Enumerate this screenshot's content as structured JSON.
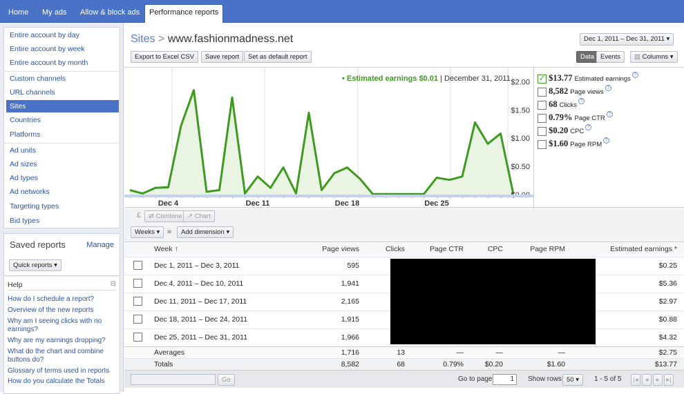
{
  "nav": {
    "tabs": [
      "Home",
      "My ads",
      "Allow & block ads",
      "Performance reports"
    ]
  },
  "sidebar": {
    "group1": [
      "Entire account by day",
      "Entire account by week",
      "Entire account by month"
    ],
    "group2": [
      "Custom channels",
      "URL channels",
      "Sites",
      "Countries",
      "Platforms"
    ],
    "group3": [
      "Ad units",
      "Ad sizes",
      "Ad types",
      "Ad networks",
      "Targeting types",
      "Bid types"
    ],
    "saved_title": "Saved reports",
    "manage": "Manage",
    "quick_reports": "Quick reports",
    "help_title": "Help",
    "help_links": [
      "How do I schedule a report?",
      "Overview of the new reports",
      "Why am I seeing clicks with no earnings?",
      "Why are my earnings dropping?",
      "What do the chart and combine buttons do?",
      "Glossary of terms used in reports",
      "How do you calculate the Totals"
    ]
  },
  "header": {
    "crumb_root": "Sites",
    "crumb_sep": ">",
    "crumb_site": "www.fashionmadness.net",
    "date_range": "Dec 1, 2011 – Dec 31, 2011",
    "export": "Export to Excel CSV",
    "save": "Save report",
    "default": "Set as default report",
    "view_data": "Data",
    "view_events": "Events",
    "columns": "Columns"
  },
  "chart": {
    "tooltip_label": "• Estimated earnings $0.01",
    "tooltip_date": "| December 31, 2011",
    "y_ticks": [
      "$2.00",
      "$1.50",
      "$1.00",
      "$0.50",
      "$0.00"
    ],
    "x_ticks": [
      "Dec 4",
      "Dec 11",
      "Dec 18",
      "Dec 25"
    ],
    "line_color": "#3d9a1e"
  },
  "legend": [
    {
      "value": "$13.77",
      "label": "Estimated earnings",
      "checked": true
    },
    {
      "value": "8,582",
      "label": "Page views",
      "checked": false
    },
    {
      "value": "68",
      "label": "Clicks",
      "checked": false
    },
    {
      "value": "0.79%",
      "label": "Page CTR",
      "checked": false
    },
    {
      "value": "$0.20",
      "label": "CPC",
      "checked": false
    },
    {
      "value": "$1.60",
      "label": "Page RPM",
      "checked": false
    }
  ],
  "toolbar": {
    "combine": "Combine",
    "chart": "Chart",
    "weeks": "Weeks",
    "add_dimension": "Add dimension"
  },
  "table": {
    "headers": [
      "Week ↑",
      "Page views",
      "Clicks",
      "Page CTR",
      "CPC",
      "Page RPM",
      "Estimated earnings *"
    ],
    "rows": [
      {
        "week": "Dec 1, 2011 – Dec 3, 2011",
        "views": "595",
        "earn": "$0.25"
      },
      {
        "week": "Dec 4, 2011 – Dec 10, 2011",
        "views": "1,941",
        "earn": "$5.36"
      },
      {
        "week": "Dec 11, 2011 – Dec 17, 2011",
        "views": "2,165",
        "earn": "$2.97"
      },
      {
        "week": "Dec 18, 2011 – Dec 24, 2011",
        "views": "1,915",
        "earn": "$0.88"
      },
      {
        "week": "Dec 25, 2011 – Dec 31, 2011",
        "views": "1,966",
        "earn": "$4.32"
      }
    ],
    "averages": {
      "label": "Averages",
      "views": "1,716",
      "clicks": "13",
      "ctr": "—",
      "cpc": "—",
      "rpm": "—",
      "earn": "$2.75"
    },
    "totals": {
      "label": "Totals",
      "views": "8,582",
      "clicks": "68",
      "ctr": "0.79%",
      "cpc": "$0.20",
      "rpm": "$1.60",
      "earn": "$13.77"
    }
  },
  "footer": {
    "go": "Go",
    "goto_label": "Go to page:",
    "page": "1",
    "show_rows": "Show rows:",
    "rows_value": "50",
    "range": "1 - 5 of 5"
  },
  "chart_data": {
    "type": "area",
    "title": "",
    "ylabel": "",
    "y_range": [
      0,
      2.2
    ],
    "x": [
      "Dec 1",
      "Dec 2",
      "Dec 3",
      "Dec 4",
      "Dec 5",
      "Dec 6",
      "Dec 7",
      "Dec 8",
      "Dec 9",
      "Dec 10",
      "Dec 11",
      "Dec 12",
      "Dec 13",
      "Dec 14",
      "Dec 15",
      "Dec 16",
      "Dec 17",
      "Dec 18",
      "Dec 19",
      "Dec 20",
      "Dec 21",
      "Dec 22",
      "Dec 23",
      "Dec 24",
      "Dec 25",
      "Dec 26",
      "Dec 27",
      "Dec 28",
      "Dec 29",
      "Dec 30",
      "Dec 31"
    ],
    "series": [
      {
        "name": "Estimated earnings",
        "values": [
          0.08,
          0.02,
          0.12,
          0.13,
          1.22,
          1.85,
          0.05,
          0.08,
          1.72,
          0.02,
          0.32,
          0.12,
          0.48,
          0.02,
          1.45,
          0.08,
          0.38,
          0.48,
          0.28,
          0.01,
          0.01,
          0.01,
          0.01,
          0.01,
          0.3,
          0.26,
          0.32,
          1.28,
          0.9,
          1.08,
          0.01
        ]
      }
    ]
  }
}
